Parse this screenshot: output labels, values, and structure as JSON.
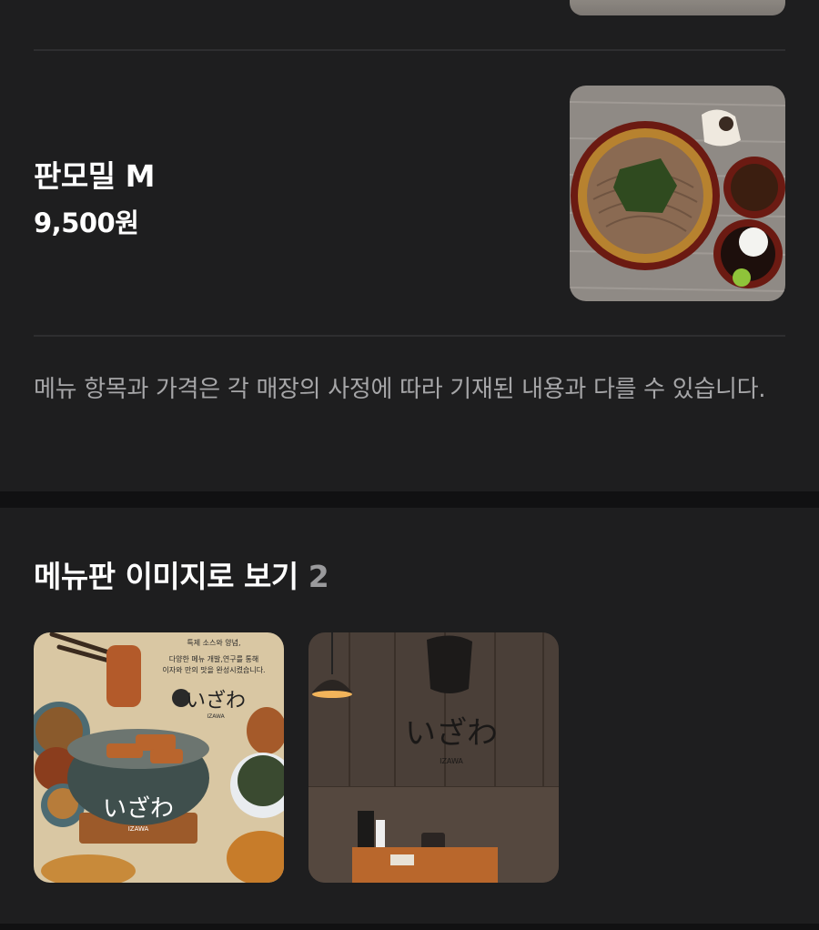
{
  "menu": {
    "item": {
      "name": "판모밀 M",
      "price": "9,500원",
      "photo_icon": "soba-dish-photo"
    },
    "notice": "메뉴 항목과 가격은 각 매장의 사정에 따라 기재된 내용과 다를 수 있습니다."
  },
  "menu_board": {
    "title": "메뉴판 이미지로 보기",
    "count": "2",
    "images": [
      {
        "icon": "menu-board-illustration",
        "brand": "いざわ",
        "brand_sub": "IZAWA",
        "text_lines": [
          "특제 소스와 양념,",
          "다양한 메뉴 개발,연구를 통해",
          "이자와 만의 맛을 완성시켰습니다."
        ]
      },
      {
        "icon": "restaurant-interior-photo",
        "brand": "いざわ",
        "brand_sub": "IZAWA"
      }
    ]
  },
  "colors": {
    "background": "#1e1e1f",
    "divider": "#2e2e30",
    "muted_text": "#a6a6a8",
    "section_gap": "#111112"
  }
}
